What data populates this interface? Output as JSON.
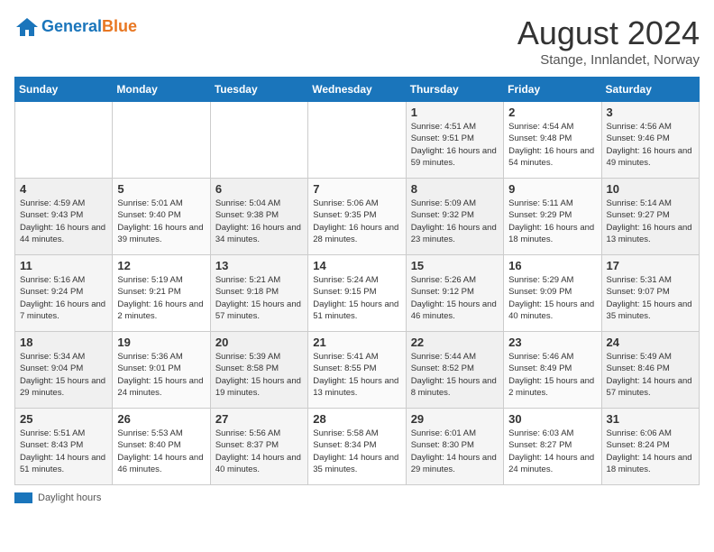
{
  "header": {
    "logo_line1": "General",
    "logo_line2": "Blue",
    "month_title": "August 2024",
    "location": "Stange, Innlandet, Norway"
  },
  "weekdays": [
    "Sunday",
    "Monday",
    "Tuesday",
    "Wednesday",
    "Thursday",
    "Friday",
    "Saturday"
  ],
  "weeks": [
    [
      {
        "num": "",
        "detail": ""
      },
      {
        "num": "",
        "detail": ""
      },
      {
        "num": "",
        "detail": ""
      },
      {
        "num": "",
        "detail": ""
      },
      {
        "num": "1",
        "detail": "Sunrise: 4:51 AM\nSunset: 9:51 PM\nDaylight: 16 hours\nand 59 minutes."
      },
      {
        "num": "2",
        "detail": "Sunrise: 4:54 AM\nSunset: 9:48 PM\nDaylight: 16 hours\nand 54 minutes."
      },
      {
        "num": "3",
        "detail": "Sunrise: 4:56 AM\nSunset: 9:46 PM\nDaylight: 16 hours\nand 49 minutes."
      }
    ],
    [
      {
        "num": "4",
        "detail": "Sunrise: 4:59 AM\nSunset: 9:43 PM\nDaylight: 16 hours\nand 44 minutes."
      },
      {
        "num": "5",
        "detail": "Sunrise: 5:01 AM\nSunset: 9:40 PM\nDaylight: 16 hours\nand 39 minutes."
      },
      {
        "num": "6",
        "detail": "Sunrise: 5:04 AM\nSunset: 9:38 PM\nDaylight: 16 hours\nand 34 minutes."
      },
      {
        "num": "7",
        "detail": "Sunrise: 5:06 AM\nSunset: 9:35 PM\nDaylight: 16 hours\nand 28 minutes."
      },
      {
        "num": "8",
        "detail": "Sunrise: 5:09 AM\nSunset: 9:32 PM\nDaylight: 16 hours\nand 23 minutes."
      },
      {
        "num": "9",
        "detail": "Sunrise: 5:11 AM\nSunset: 9:29 PM\nDaylight: 16 hours\nand 18 minutes."
      },
      {
        "num": "10",
        "detail": "Sunrise: 5:14 AM\nSunset: 9:27 PM\nDaylight: 16 hours\nand 13 minutes."
      }
    ],
    [
      {
        "num": "11",
        "detail": "Sunrise: 5:16 AM\nSunset: 9:24 PM\nDaylight: 16 hours\nand 7 minutes."
      },
      {
        "num": "12",
        "detail": "Sunrise: 5:19 AM\nSunset: 9:21 PM\nDaylight: 16 hours\nand 2 minutes."
      },
      {
        "num": "13",
        "detail": "Sunrise: 5:21 AM\nSunset: 9:18 PM\nDaylight: 15 hours\nand 57 minutes."
      },
      {
        "num": "14",
        "detail": "Sunrise: 5:24 AM\nSunset: 9:15 PM\nDaylight: 15 hours\nand 51 minutes."
      },
      {
        "num": "15",
        "detail": "Sunrise: 5:26 AM\nSunset: 9:12 PM\nDaylight: 15 hours\nand 46 minutes."
      },
      {
        "num": "16",
        "detail": "Sunrise: 5:29 AM\nSunset: 9:09 PM\nDaylight: 15 hours\nand 40 minutes."
      },
      {
        "num": "17",
        "detail": "Sunrise: 5:31 AM\nSunset: 9:07 PM\nDaylight: 15 hours\nand 35 minutes."
      }
    ],
    [
      {
        "num": "18",
        "detail": "Sunrise: 5:34 AM\nSunset: 9:04 PM\nDaylight: 15 hours\nand 29 minutes."
      },
      {
        "num": "19",
        "detail": "Sunrise: 5:36 AM\nSunset: 9:01 PM\nDaylight: 15 hours\nand 24 minutes."
      },
      {
        "num": "20",
        "detail": "Sunrise: 5:39 AM\nSunset: 8:58 PM\nDaylight: 15 hours\nand 19 minutes."
      },
      {
        "num": "21",
        "detail": "Sunrise: 5:41 AM\nSunset: 8:55 PM\nDaylight: 15 hours\nand 13 minutes."
      },
      {
        "num": "22",
        "detail": "Sunrise: 5:44 AM\nSunset: 8:52 PM\nDaylight: 15 hours\nand 8 minutes."
      },
      {
        "num": "23",
        "detail": "Sunrise: 5:46 AM\nSunset: 8:49 PM\nDaylight: 15 hours\nand 2 minutes."
      },
      {
        "num": "24",
        "detail": "Sunrise: 5:49 AM\nSunset: 8:46 PM\nDaylight: 14 hours\nand 57 minutes."
      }
    ],
    [
      {
        "num": "25",
        "detail": "Sunrise: 5:51 AM\nSunset: 8:43 PM\nDaylight: 14 hours\nand 51 minutes."
      },
      {
        "num": "26",
        "detail": "Sunrise: 5:53 AM\nSunset: 8:40 PM\nDaylight: 14 hours\nand 46 minutes."
      },
      {
        "num": "27",
        "detail": "Sunrise: 5:56 AM\nSunset: 8:37 PM\nDaylight: 14 hours\nand 40 minutes."
      },
      {
        "num": "28",
        "detail": "Sunrise: 5:58 AM\nSunset: 8:34 PM\nDaylight: 14 hours\nand 35 minutes."
      },
      {
        "num": "29",
        "detail": "Sunrise: 6:01 AM\nSunset: 8:30 PM\nDaylight: 14 hours\nand 29 minutes."
      },
      {
        "num": "30",
        "detail": "Sunrise: 6:03 AM\nSunset: 8:27 PM\nDaylight: 14 hours\nand 24 minutes."
      },
      {
        "num": "31",
        "detail": "Sunrise: 6:06 AM\nSunset: 8:24 PM\nDaylight: 14 hours\nand 18 minutes."
      }
    ]
  ],
  "legend": {
    "label": "Daylight hours"
  }
}
